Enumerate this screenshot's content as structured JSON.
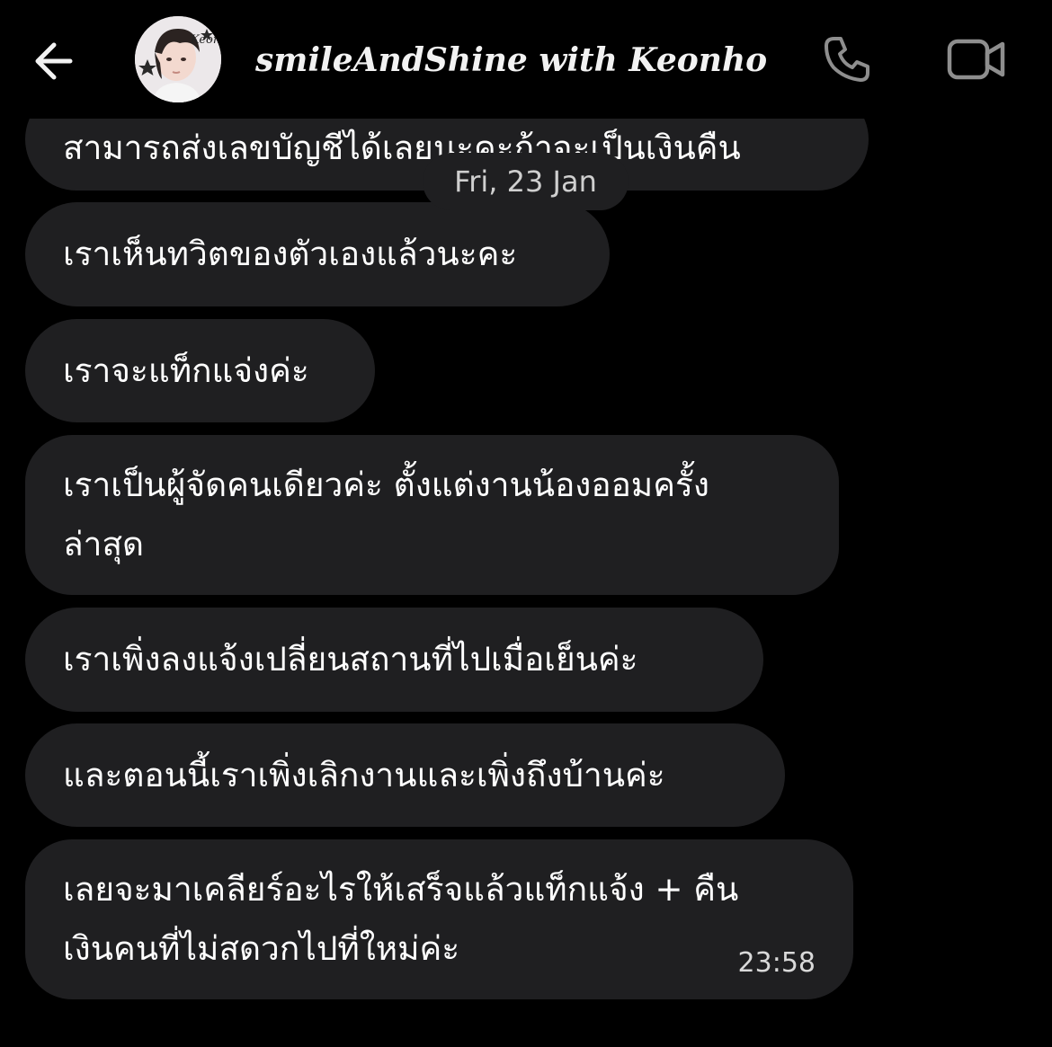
{
  "header": {
    "title": "smileAndShine with Keonho",
    "avatar_label": "Keon Ho",
    "back_icon": "arrow-left-icon",
    "call_icon": "phone-icon",
    "video_icon": "video-camera-icon"
  },
  "date_separator": "Fri, 23 Jan",
  "messages": [
    {
      "text": "สามารถส่งเลขบัญชีได้เลยนะคะถ้าจะเป็นเงินคืน"
    },
    {
      "text": "เราเห็นทวิตของตัวเองแล้วนะคะ"
    },
    {
      "text": "เราจะแท็กแจ่งค่ะ"
    },
    {
      "lines": [
        "เราเป็นผู้จัดคนเดียวค่ะ ตั้งแต่งานน้องออมครั้ง",
        "ล่าสุด"
      ]
    },
    {
      "text": "เราเพิ่งลงแจ้งเปลี่ยนสถานที่ไปเมื่อเย็นค่ะ"
    },
    {
      "text": "และตอนนี้เราเพิ่งเลิกงานและเพิ่งถึงบ้านค่ะ"
    },
    {
      "lines": [
        "เลยจะมาเคลียร์อะไรให้เสร็จแล้วแท็กแจ้ง + คืน",
        "เงินคนที่ไม่สดวกไปที่ใหม่ค่ะ"
      ],
      "time": "23:58"
    }
  ],
  "colors": {
    "background": "#000000",
    "bubble": "#1f1f21",
    "text": "#ffffff",
    "icon": "#8e8e8e"
  }
}
